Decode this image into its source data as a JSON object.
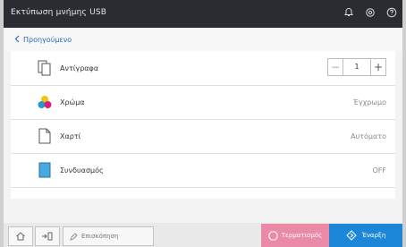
{
  "header": {
    "title": "Εκτύπωση μνήμης USB",
    "icons": [
      "bell-icon",
      "settings-icon",
      "help-icon"
    ]
  },
  "nav": {
    "back_label": "Προηγούμενο"
  },
  "settings": {
    "copies": {
      "label": "Αντίγραφα",
      "value": "1",
      "minus": "−",
      "plus": "+"
    },
    "color": {
      "label": "Χρώμα",
      "value": "Έγχρωμο"
    },
    "paper": {
      "label": "Χαρτί",
      "value": "Αυτόματο"
    },
    "combine": {
      "label": "Συνδυασμός",
      "value": "OFF"
    }
  },
  "footer": {
    "review_label": "Επισκόπηση",
    "stop_label": "Τερματισμός",
    "start_label": "Έναρξη"
  },
  "colors": {
    "titlebar": "#2a2c31",
    "accent_blue": "#1c86d8",
    "stop_pink": "#ea8aa6",
    "link_blue": "#2a69b5"
  }
}
